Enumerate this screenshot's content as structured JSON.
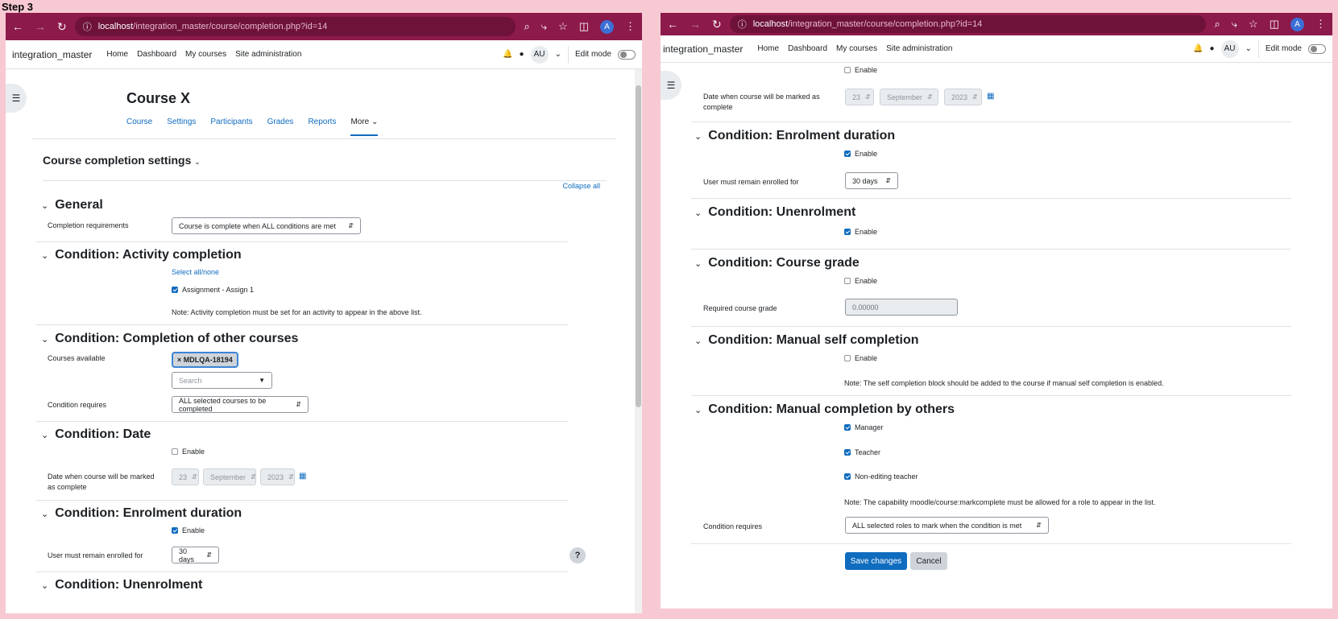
{
  "step_label": "Step 3",
  "browser": {
    "url_host": "localhost",
    "url_path": "/integration_master/course/completion.php?id=14",
    "avatar": "A"
  },
  "moodle": {
    "site_name": "integration_master",
    "nav": [
      "Home",
      "Dashboard",
      "My courses",
      "Site administration"
    ],
    "user_initials": "AU",
    "edit_mode": "Edit mode"
  },
  "course": {
    "title": "Course X",
    "tabs": [
      "Course",
      "Settings",
      "Participants",
      "Grades",
      "Reports",
      "More"
    ]
  },
  "form": {
    "title": "Course completion settings",
    "collapse_all": "Collapse all",
    "general": {
      "header": "General",
      "req_label": "Completion requirements",
      "req_value": "Course is complete when ALL conditions are met"
    },
    "activity": {
      "header": "Condition: Activity completion",
      "select_all": "Select all/none",
      "item": "Assignment - Assign 1",
      "note": "Note: Activity completion must be set for an activity to appear in the above list."
    },
    "other_courses": {
      "header": "Condition: Completion of other courses",
      "available_label": "Courses available",
      "chip": "× MDLQA-18194",
      "search_placeholder": "Search",
      "requires_label": "Condition requires",
      "requires_value": "ALL selected courses to be completed"
    },
    "date": {
      "header": "Condition: Date",
      "enable": "Enable",
      "label": "Date when course will be marked as complete",
      "day": "23",
      "month": "September",
      "year": "2023"
    },
    "enrolment": {
      "header": "Condition: Enrolment duration",
      "enable": "Enable",
      "label": "User must remain enrolled for",
      "value": "30 days"
    },
    "unenrolment": {
      "header": "Condition: Unenrolment",
      "enable": "Enable"
    },
    "grade": {
      "header": "Condition: Course grade",
      "enable": "Enable",
      "label": "Required course grade",
      "value": "0.00000"
    },
    "self": {
      "header": "Condition: Manual self completion",
      "enable": "Enable",
      "note": "Note: The self completion block should be added to the course if manual self completion is enabled."
    },
    "others": {
      "header": "Condition: Manual completion by others",
      "roles": [
        "Manager",
        "Teacher",
        "Non-editing teacher"
      ],
      "note": "Note: The capability moodle/course:markcomplete must be allowed for a role to appear in the list.",
      "requires_label": "Condition requires",
      "requires_value": "ALL selected roles to mark when the condition is met"
    },
    "save": "Save changes",
    "cancel": "Cancel"
  },
  "help": "?"
}
